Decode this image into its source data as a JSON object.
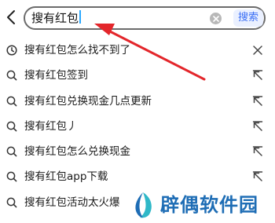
{
  "search": {
    "query": "搜有红包",
    "button_label": "搜索"
  },
  "suggestions": [
    {
      "text": "搜有红包怎么找不到了",
      "lead_icon": "history-clock-icon",
      "trail_icon": "close-icon"
    },
    {
      "text": "搜有红包签到",
      "lead_icon": "search-icon",
      "trail_icon": "fill-arrow-icon"
    },
    {
      "text": "搜有红包兑换现金几点更新",
      "lead_icon": "search-icon",
      "trail_icon": "fill-arrow-icon"
    },
    {
      "text": "搜有红包丿",
      "lead_icon": "search-icon",
      "trail_icon": "fill-arrow-icon"
    },
    {
      "text": "搜有红包怎么兑换现金",
      "lead_icon": "search-icon",
      "trail_icon": "fill-arrow-icon"
    },
    {
      "text": "搜有红包app下载",
      "lead_icon": "search-icon",
      "trail_icon": "fill-arrow-icon"
    },
    {
      "text": "搜有红包活动太火爆",
      "lead_icon": "search-icon",
      "trail_icon": "fill-arrow-icon"
    }
  ],
  "watermark": {
    "text": "辟偶软件园"
  },
  "colors": {
    "annotation_arrow": "#e3262b",
    "search_button_text": "#3b6ff5",
    "search_button_bg": "#eaf0ff",
    "caret": "#2aa8ff",
    "watermark": "#1e6db5"
  }
}
